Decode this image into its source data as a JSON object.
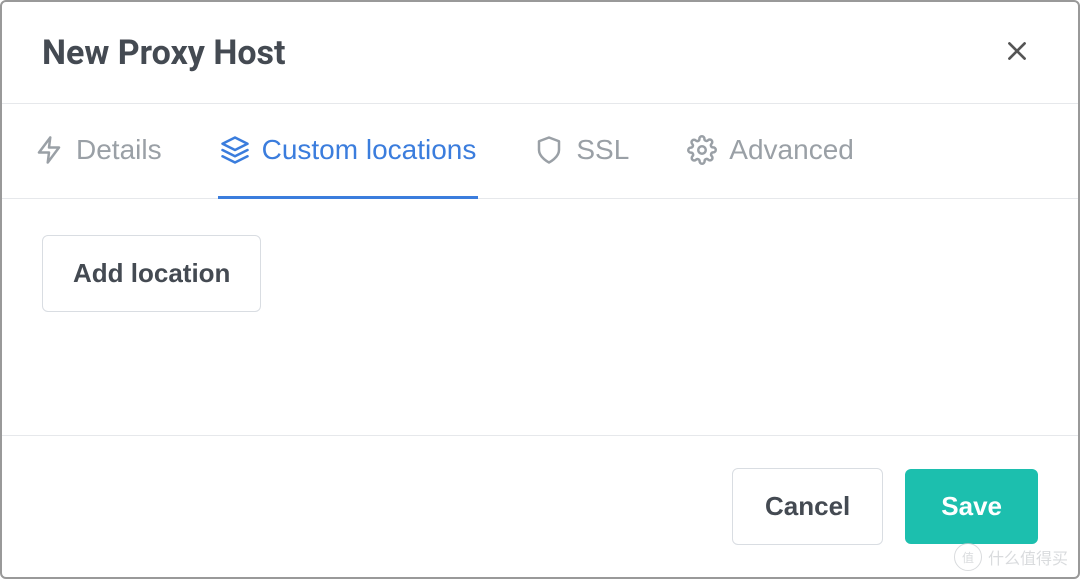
{
  "modal": {
    "title": "New Proxy Host"
  },
  "tabs": {
    "details": {
      "label": "Details"
    },
    "custom_locations": {
      "label": "Custom locations"
    },
    "ssl": {
      "label": "SSL"
    },
    "advanced": {
      "label": "Advanced"
    }
  },
  "body": {
    "add_location_label": "Add location"
  },
  "footer": {
    "cancel_label": "Cancel",
    "save_label": "Save"
  },
  "watermark": {
    "text": "什么值得买",
    "badge": "值"
  },
  "colors": {
    "accent": "#3b7ddd",
    "save": "#1cbfae"
  }
}
